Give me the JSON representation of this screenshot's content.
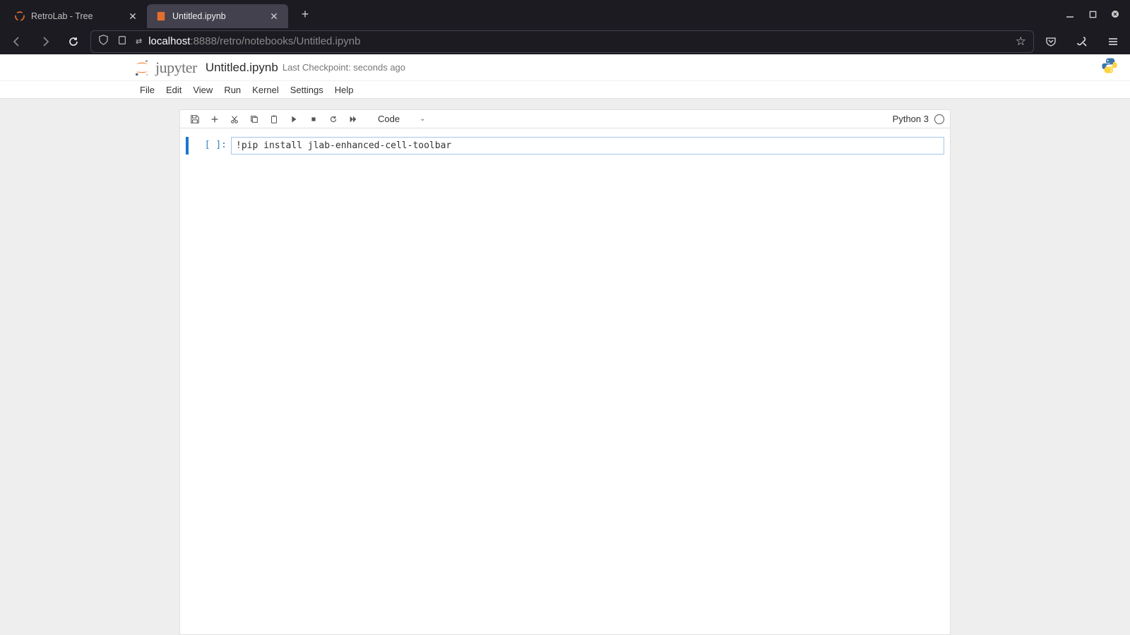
{
  "browser": {
    "tabs": [
      {
        "title": "RetroLab - Tree",
        "active": false
      },
      {
        "title": "Untitled.ipynb",
        "active": true
      }
    ],
    "url": {
      "host": "localhost",
      "port": ":8888",
      "path": "/retro/notebooks/Untitled.ipynb"
    }
  },
  "jupyter": {
    "logo_text": "jupyter",
    "filename": "Untitled.ipynb",
    "checkpoint": "Last Checkpoint: seconds ago",
    "menu": [
      "File",
      "Edit",
      "View",
      "Run",
      "Kernel",
      "Settings",
      "Help"
    ],
    "toolbar": {
      "cell_type": "Code",
      "kernel_name": "Python 3"
    },
    "cell": {
      "prompt": "[ ]:",
      "content": "!pip install jlab-enhanced-cell-toolbar"
    }
  }
}
